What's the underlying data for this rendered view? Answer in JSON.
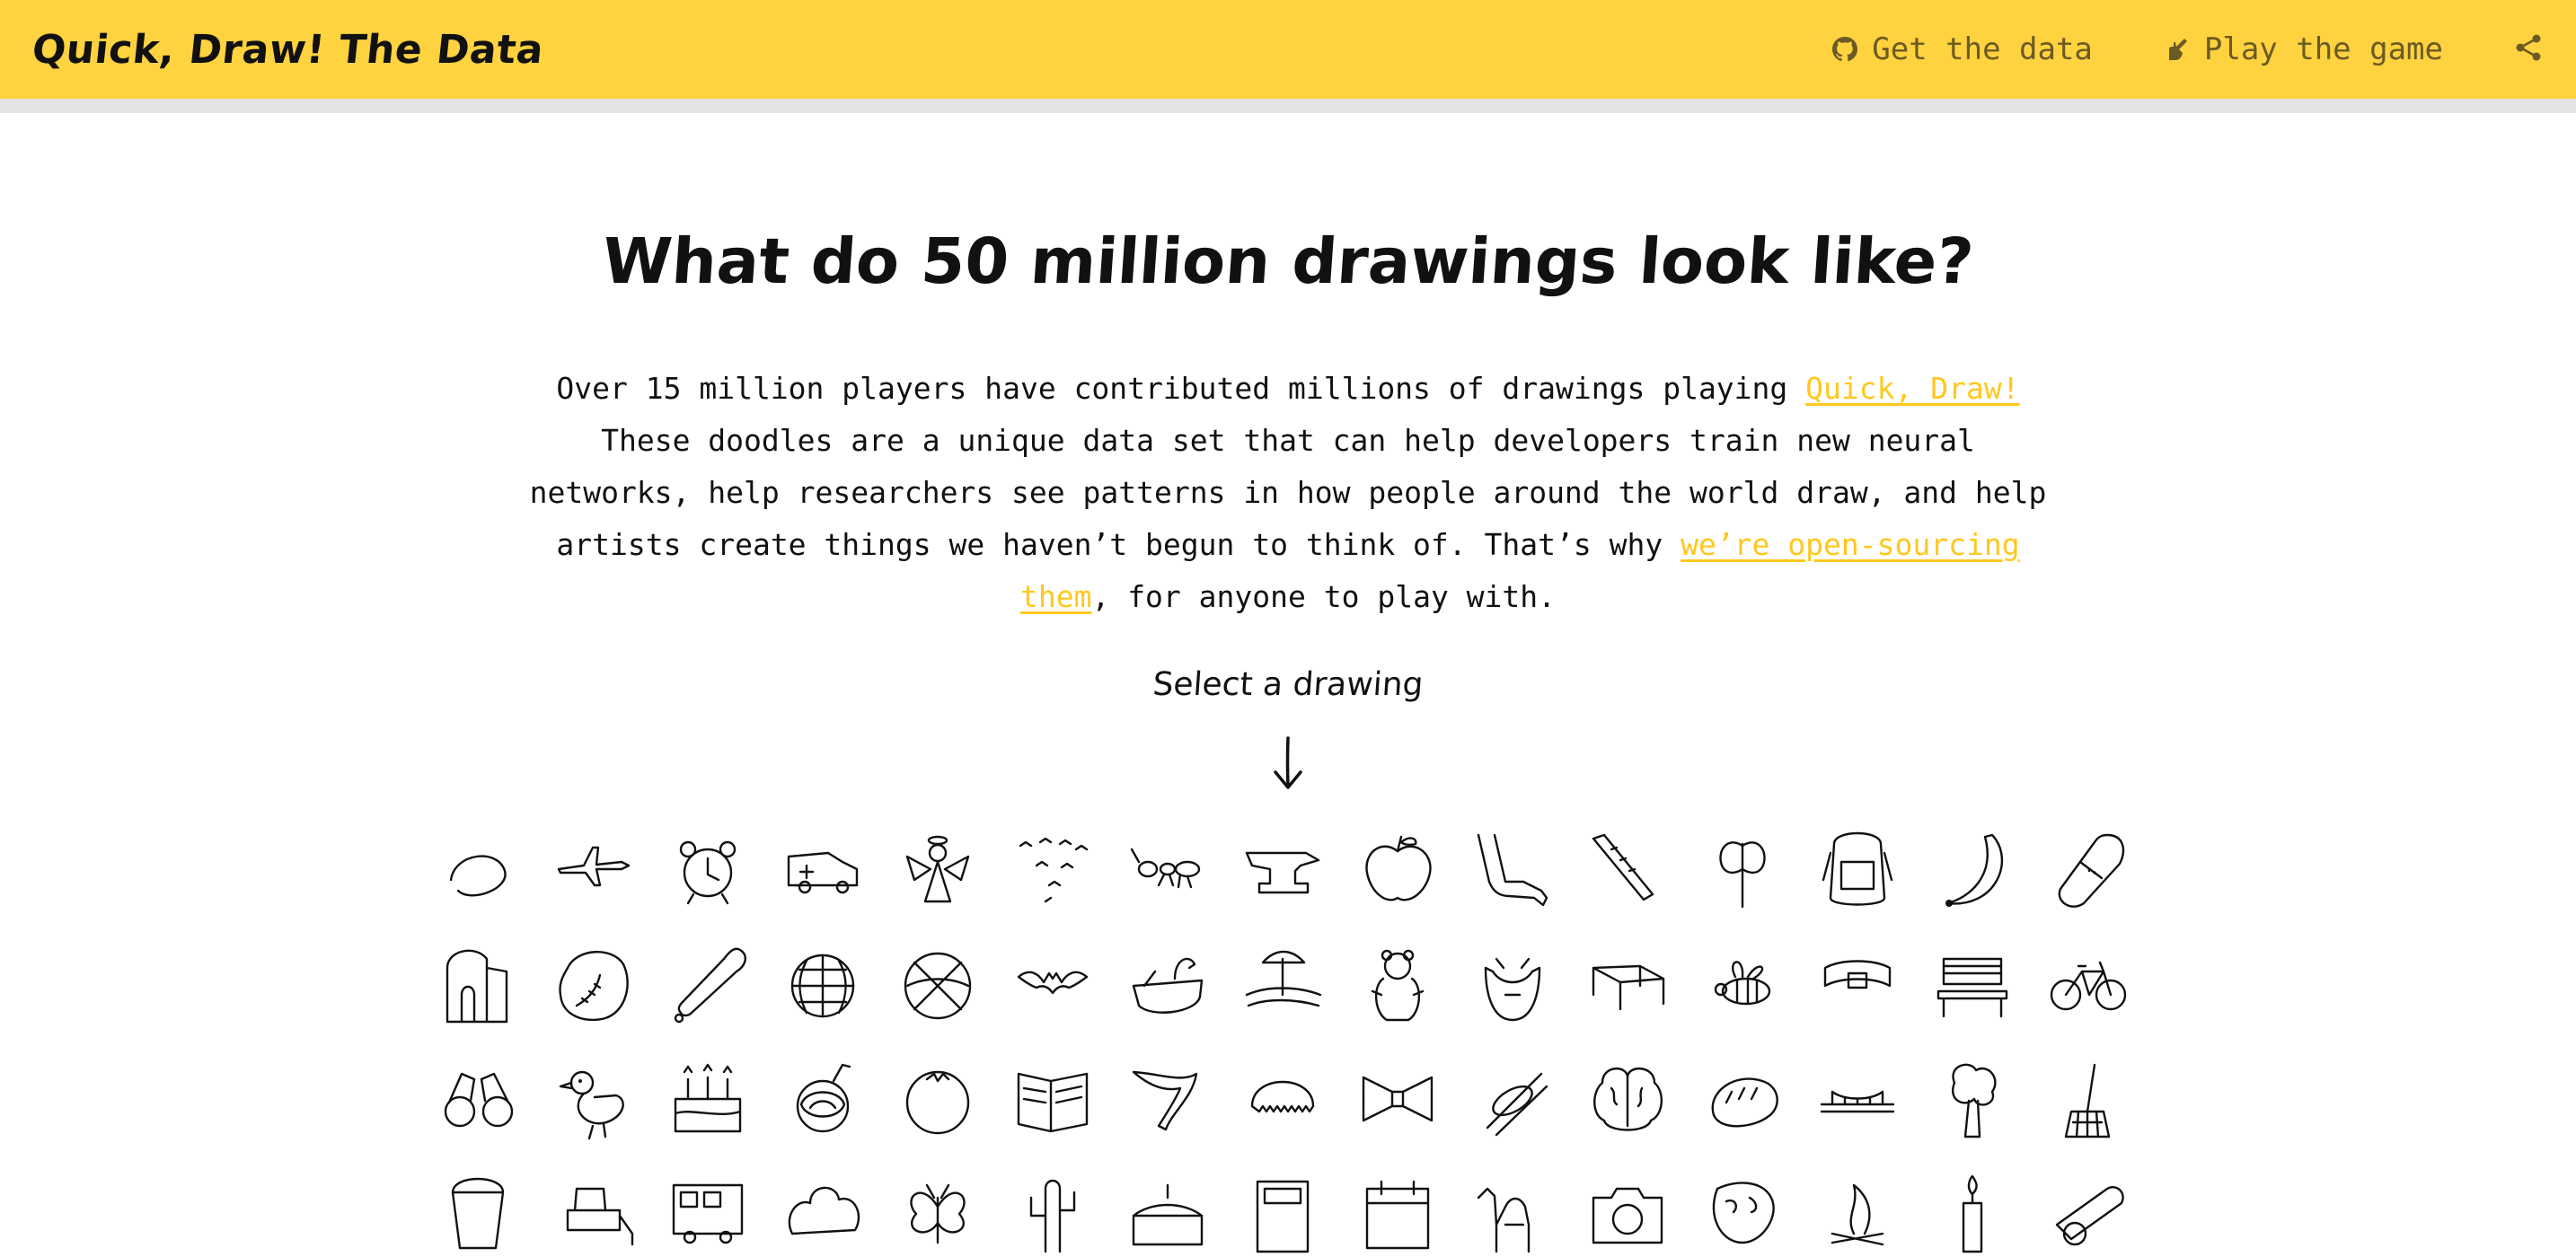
{
  "header": {
    "brand": "Quick, Draw! The Data",
    "nav": [
      {
        "label": "Get the data",
        "icon": "github-icon"
      },
      {
        "label": "Play the game",
        "icon": "pencil-hand-icon"
      }
    ],
    "share_icon": "share-icon",
    "colors": {
      "bar": "#ffd23f",
      "nav_text": "#6b5a24"
    }
  },
  "hero": {
    "title": "What do 50 million drawings look like?",
    "intro_before_link1": "Over 15 million players have contributed millions of drawings playing ",
    "link1": "Quick, Draw!",
    "intro_middle": " These doodles are a unique data set that can help developers train new neural networks, help researchers see patterns in how people around the world draw, and help artists create things we haven’t begun to think of. That’s why ",
    "link2": "we’re open-sourcing them",
    "intro_after_link2": ", for anyone to play with.",
    "link_color": "#ffc81f"
  },
  "selector": {
    "label": "Select a drawing",
    "arrow_icon": "arrow-down-icon"
  },
  "drawings": [
    [
      "aircraft carrier",
      "airplane",
      "alarm clock",
      "ambulance",
      "angel",
      "animal migration",
      "ant",
      "anvil",
      "apple",
      "arm",
      "asparagus",
      "axe",
      "backpack",
      "banana",
      "bandage"
    ],
    [
      "barn",
      "baseball",
      "baseball bat",
      "basket",
      "basketball",
      "bat",
      "bathtub",
      "beach",
      "bear",
      "beard",
      "bed",
      "bee",
      "belt",
      "bench",
      "bicycle"
    ],
    [
      "binoculars",
      "bird",
      "birthday cake",
      "blackberry",
      "blueberry",
      "book",
      "boomerang",
      "bottlecap",
      "bowtie",
      "bracelet",
      "brain",
      "bread",
      "bridge",
      "broccoli",
      "broom"
    ],
    [
      "bucket",
      "bulldozer",
      "bus",
      "bush",
      "butterfly",
      "cactus",
      "cake",
      "calculator",
      "calendar",
      "camel",
      "camera",
      "camouflage",
      "campfire",
      "candle",
      "cannon"
    ]
  ]
}
